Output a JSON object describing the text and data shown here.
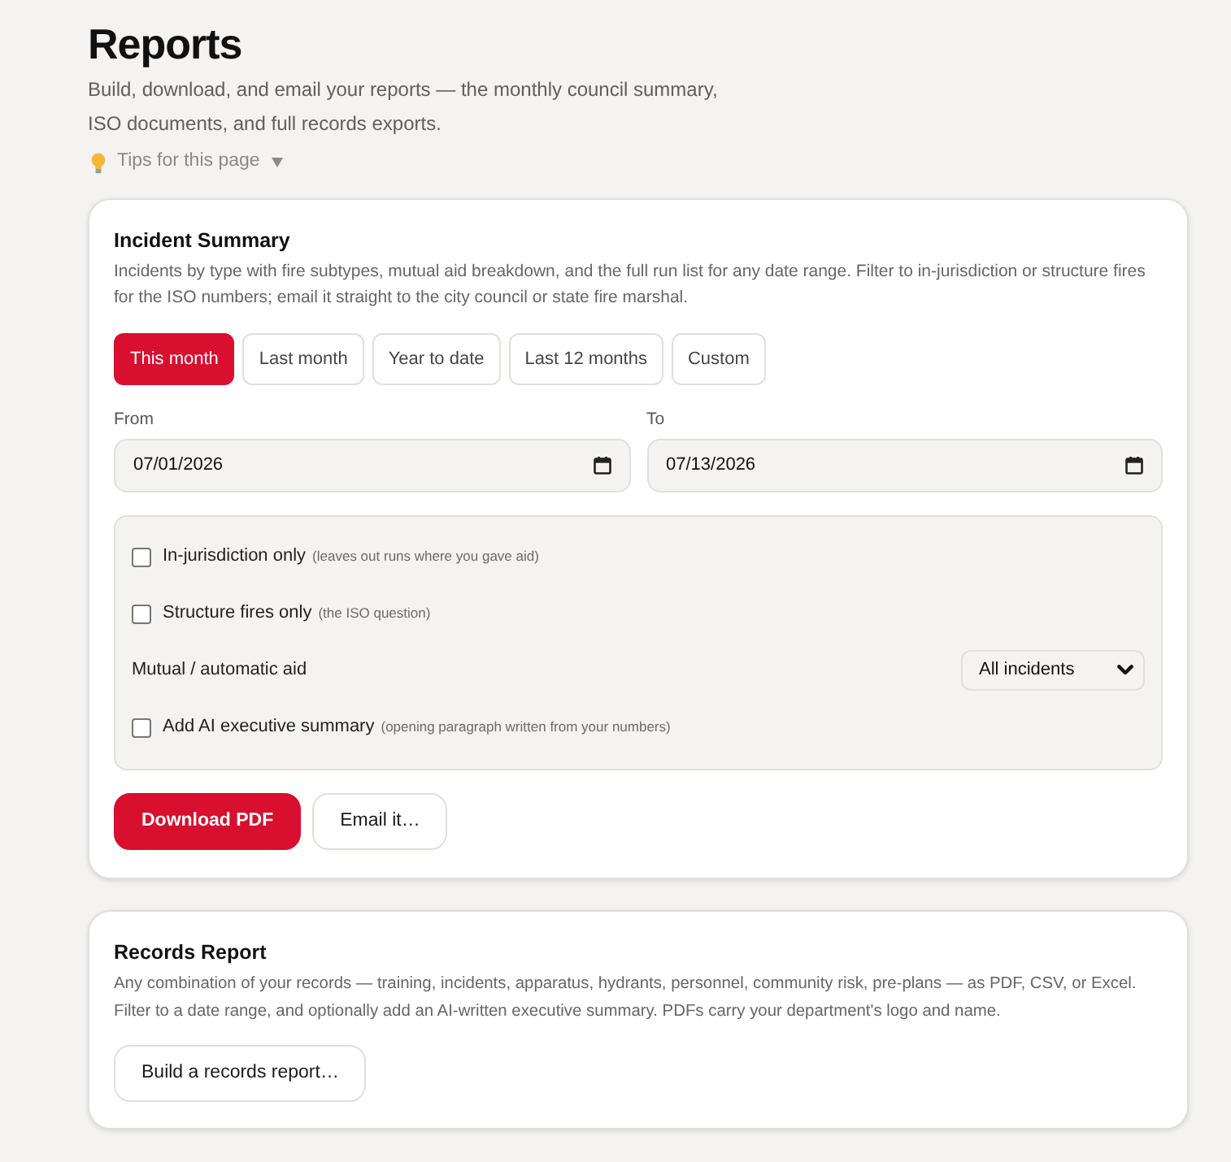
{
  "page": {
    "title": "Reports",
    "subtitle": "Build, download, and email your reports — the monthly council summary, ISO documents, and full records exports.",
    "tips": {
      "label": "Tips for this page",
      "expanded": false
    }
  },
  "incident_summary": {
    "title": "Incident Summary",
    "description": "Incidents by type with fire subtypes, mutual aid breakdown, and the full run list for any date range. Filter to in-jurisdiction or structure fires for the ISO numbers; email it straight to the city council or state fire marshal.",
    "presets": [
      {
        "label": "This month",
        "selected": true
      },
      {
        "label": "Last month",
        "selected": false
      },
      {
        "label": "Year to date",
        "selected": false
      },
      {
        "label": "Last 12 months",
        "selected": false
      },
      {
        "label": "Custom",
        "selected": false
      }
    ],
    "date_range": [
      {
        "label": "From",
        "value": "07/01/2026"
      },
      {
        "label": "To",
        "value": "07/13/2026"
      }
    ],
    "filters": [
      {
        "kind": "checkbox",
        "label": "In-jurisdiction only",
        "hint": "(leaves out runs where you gave aid)",
        "checked": false
      },
      {
        "kind": "checkbox",
        "label": "Structure fires only",
        "hint": "(the ISO question)",
        "checked": false
      },
      {
        "kind": "select",
        "label": "Mutual / automatic aid",
        "value": "All incidents"
      },
      {
        "kind": "checkbox",
        "label": "Add AI executive summary",
        "hint": "(opening paragraph written from your numbers)",
        "checked": false
      }
    ],
    "actions": [
      {
        "kind": "primary",
        "label": "Download PDF"
      },
      {
        "kind": "secondary",
        "label": "Email it…"
      }
    ]
  },
  "records_report": {
    "title": "Records Report",
    "description": "Any combination of your records — training, incidents, apparatus, hydrants, personnel, community risk, pre-plans — as PDF, CSV, or Excel. Filter to a date range, and optionally add an AI-written executive summary. PDFs carry your department's logo and name.",
    "actions": [
      {
        "kind": "secondary",
        "label": "Build a records report…"
      }
    ]
  }
}
